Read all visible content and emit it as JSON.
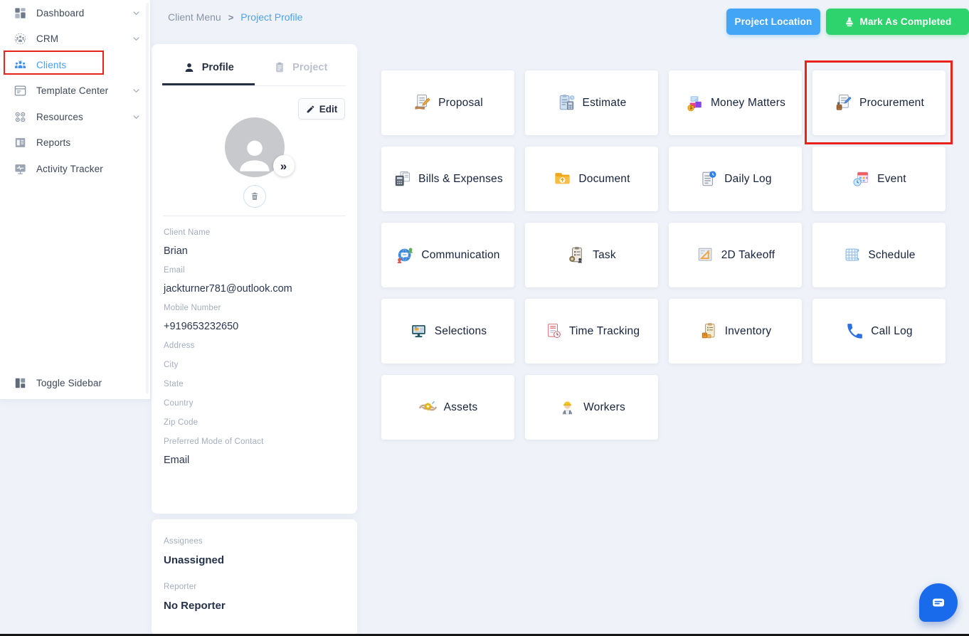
{
  "sidebar": {
    "items": [
      {
        "label": "Dashboard",
        "icon": "dashboard-icon",
        "chevron": true,
        "active": false,
        "annotated": false
      },
      {
        "label": "CRM",
        "icon": "crm-icon",
        "chevron": true,
        "active": false,
        "annotated": false
      },
      {
        "label": "Clients",
        "icon": "clients-icon",
        "chevron": false,
        "active": true,
        "annotated": true
      },
      {
        "label": "Template Center",
        "icon": "template-center-icon",
        "chevron": true,
        "active": false,
        "annotated": false
      },
      {
        "label": "Resources",
        "icon": "resources-icon",
        "chevron": true,
        "active": false,
        "annotated": false
      },
      {
        "label": "Reports",
        "icon": "reports-icon",
        "chevron": false,
        "active": false,
        "annotated": false
      },
      {
        "label": "Activity Tracker",
        "icon": "activity-tracker-icon",
        "chevron": false,
        "active": false,
        "annotated": false
      }
    ],
    "toggle": {
      "label": "Toggle Sidebar",
      "icon": "toggle-sidebar-icon"
    }
  },
  "header": {
    "breadcrumb": {
      "root": "Client Menu",
      "separator": ">",
      "current": "Project Profile"
    },
    "project_location_label": "Project Location",
    "mark_completed_label": "Mark As Completed",
    "mark_completed_icon": "stamp-icon"
  },
  "profile_panel": {
    "tabs": [
      {
        "label": "Profile",
        "icon": "profile-tab-icon",
        "active": true
      },
      {
        "label": "Project",
        "icon": "project-tab-icon",
        "active": false
      }
    ],
    "edit_label": "Edit",
    "avatar_badge": "»",
    "fields": [
      {
        "label": "Client Name",
        "value": "Brian"
      },
      {
        "label": "Email",
        "value": "jackturner781@outlook.com"
      },
      {
        "label": "Mobile Number",
        "value": "+919653232650"
      },
      {
        "label": "Address",
        "value": ""
      },
      {
        "label": "City",
        "value": ""
      },
      {
        "label": "State",
        "value": ""
      },
      {
        "label": "Country",
        "value": ""
      },
      {
        "label": "Zip Code",
        "value": ""
      },
      {
        "label": "Preferred Mode of Contact",
        "value": "Email"
      }
    ]
  },
  "assignment_panel": {
    "fields": [
      {
        "label": "Assignees",
        "value": "Unassigned"
      },
      {
        "label": "Reporter",
        "value": "No Reporter"
      }
    ]
  },
  "modules": [
    {
      "label": "Proposal",
      "icon": "proposal-icon",
      "annotated": false
    },
    {
      "label": "Estimate",
      "icon": "estimate-icon",
      "annotated": false
    },
    {
      "label": "Money Matters",
      "icon": "money-matters-icon",
      "annotated": false
    },
    {
      "label": "Procurement",
      "icon": "procurement-icon",
      "annotated": true
    },
    {
      "label": "Bills & Expenses",
      "icon": "bills-expenses-icon",
      "annotated": false
    },
    {
      "label": "Document",
      "icon": "document-icon",
      "annotated": false
    },
    {
      "label": "Daily Log",
      "icon": "daily-log-icon",
      "annotated": false
    },
    {
      "label": "Event",
      "icon": "event-icon",
      "annotated": false
    },
    {
      "label": "Communication",
      "icon": "communication-icon",
      "annotated": false
    },
    {
      "label": "Task",
      "icon": "task-icon",
      "annotated": false
    },
    {
      "label": "2D Takeoff",
      "icon": "takeoff-2d-icon",
      "annotated": false
    },
    {
      "label": "Schedule",
      "icon": "schedule-icon",
      "annotated": false
    },
    {
      "label": "Selections",
      "icon": "selections-icon",
      "annotated": false
    },
    {
      "label": "Time Tracking",
      "icon": "time-tracking-icon",
      "annotated": false
    },
    {
      "label": "Inventory",
      "icon": "inventory-icon",
      "annotated": false
    },
    {
      "label": "Call Log",
      "icon": "call-log-icon",
      "annotated": false
    },
    {
      "label": "Assets",
      "icon": "assets-icon",
      "annotated": false
    },
    {
      "label": "Workers",
      "icon": "workers-icon",
      "annotated": false
    }
  ],
  "chat": {
    "icon": "chat-icon"
  },
  "colors": {
    "accent_blue": "#42a5f5",
    "accent_green": "#2ed36e",
    "annotation_red": "#e8231c",
    "chat_blue": "#1a6beb",
    "background": "#eff3f9"
  }
}
